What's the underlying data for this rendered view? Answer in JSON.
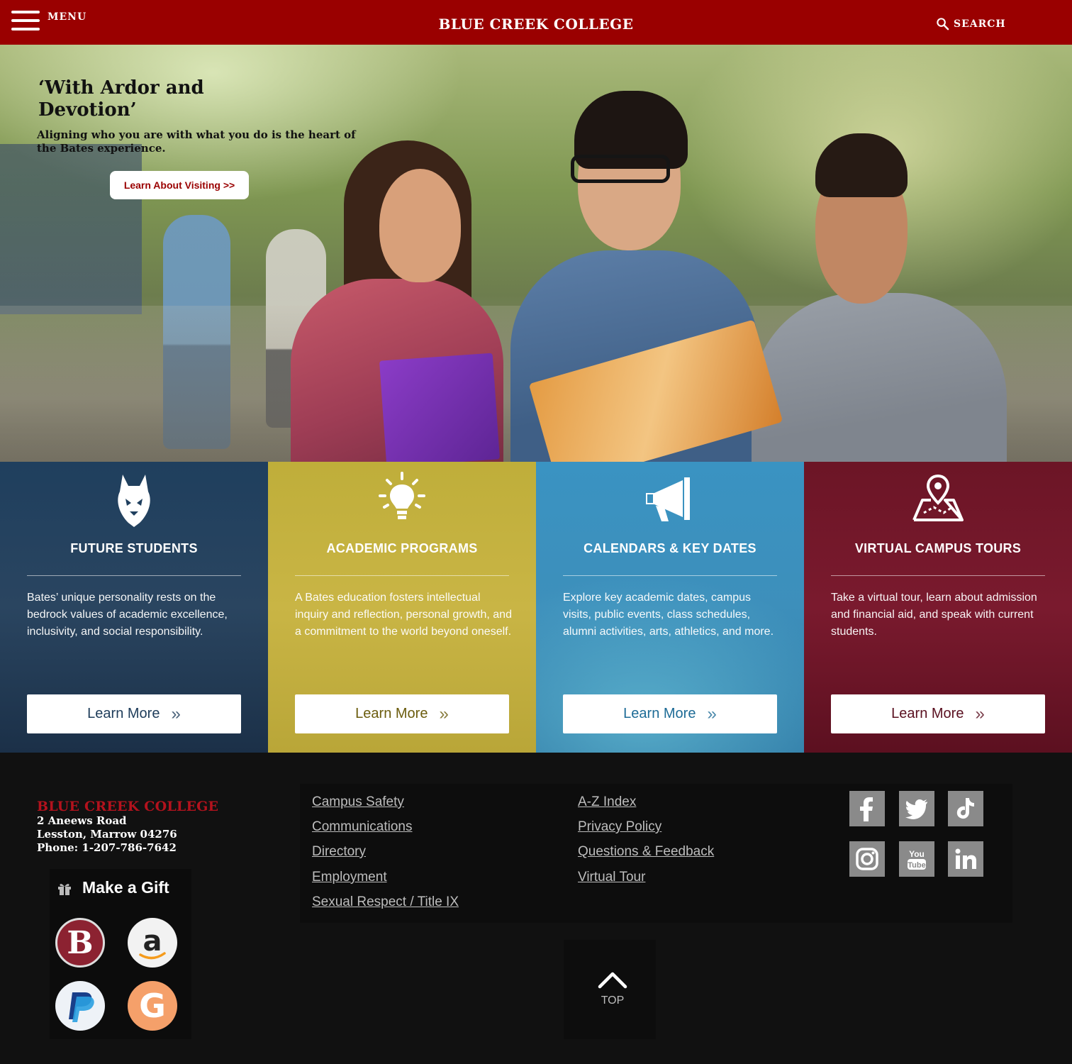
{
  "header": {
    "menu_label": "MENU",
    "site_title": "BLUE CREEK COLLEGE",
    "search_label": "SEARCH",
    "bg_color": "#9a0000"
  },
  "hero": {
    "title": "‘With Ardor and Devotion’",
    "subtitle": "Aligning who you are with what you do is the heart of the Bates experience.",
    "cta_label": "Learn About Visiting  >>"
  },
  "cards": [
    {
      "icon": "bobcat-icon",
      "title": "FUTURE STUDENTS",
      "text": "Bates’ unique personality rests on the bedrock values of academic excellence, inclusivity, and social responsibility.",
      "button_label": "Learn More",
      "color": "#1e3c5a"
    },
    {
      "icon": "lightbulb-icon",
      "title": "ACADEMIC PROGRAMS",
      "text": "A Bates education fosters intellectual inquiry and reflection, personal growth, and a commitment to the world beyond oneself.",
      "button_label": "Learn More",
      "color": "#c8b53a"
    },
    {
      "icon": "megaphone-icon",
      "title": "CALENDARS & KEY DATES",
      "text": "Explore key academic dates, campus visits, public events, class schedules, alumni activities, arts, athletics, and more.",
      "button_label": "Learn More",
      "color": "#3a8fbd"
    },
    {
      "icon": "map-pin-icon",
      "title": "VIRTUAL CAMPUS TOURS",
      "text": "Take a virtual tour, learn about admission and financial aid, and speak with current students.",
      "button_label": "Learn More",
      "color": "#6e1426"
    }
  ],
  "footer": {
    "college_name": "BLUE CREEK COLLEGE",
    "address_line1": "2 Aneews Road",
    "address_line2": "Lesston, Marrow 04276",
    "phone": "Phone: 1-207-786-7642",
    "gift_label": "Make a Gift",
    "donate_b_letter": "B",
    "donate_g_letter": "G",
    "links_col1": [
      "Campus Safety",
      "Communications",
      "Directory",
      "Employment",
      "Sexual Respect / Title IX"
    ],
    "links_col2": [
      "A-Z Index",
      "Privacy Policy",
      "Questions & Feedback",
      "Virtual Tour"
    ],
    "social": [
      "facebook-icon",
      "twitter-icon",
      "tiktok-icon",
      "instagram-icon",
      "youtube-icon",
      "linkedin-icon"
    ],
    "top_label": "TOP"
  }
}
